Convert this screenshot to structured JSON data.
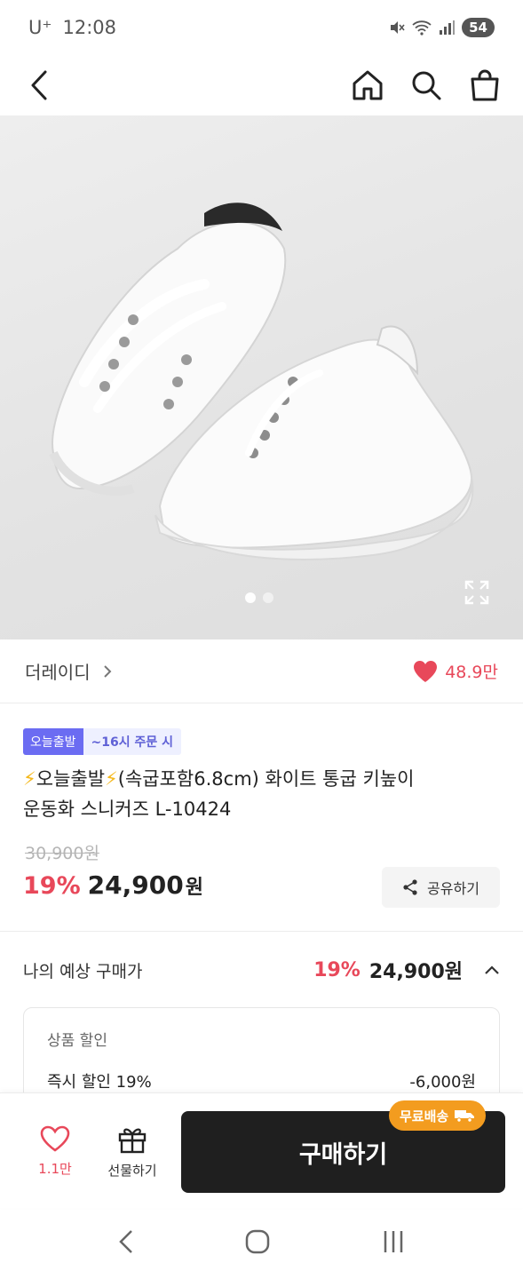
{
  "status_bar": {
    "carrier": "U⁺",
    "time": "12:08",
    "battery": "54"
  },
  "product": {
    "image_page_total": 2,
    "image_page_current": 1,
    "brand": "더레이디",
    "likes_count": "48.9만",
    "badge_today": "오늘출발",
    "badge_time": "~16시 주문 시",
    "title_line1": "오늘출발",
    "title_line1_rest": "(속굽포함6.8cm) 화이트 통굽 키높이",
    "title_line2": "운동화 스니커즈 L-10424",
    "original_price": "30,900원",
    "discount_rate": "19%",
    "price": "24,900",
    "price_unit": "원",
    "share_label": "공유하기"
  },
  "expected_price": {
    "label": "나의 예상 구매가",
    "discount_rate": "19%",
    "price": "24,900원"
  },
  "discount_box": {
    "title": "상품 할인",
    "row_label": "즉시 할인 19%",
    "row_amount": "-6,000원"
  },
  "bottom_bar": {
    "like_count": "1.1만",
    "gift_label": "선물하기",
    "buy_label": "구매하기",
    "free_shipping_label": "무료배송"
  },
  "colors": {
    "accent_red": "#e8485a",
    "today_badge": "#6b6cf2",
    "free_ship": "#f39c1f",
    "buy_button": "#1f1f1f"
  }
}
